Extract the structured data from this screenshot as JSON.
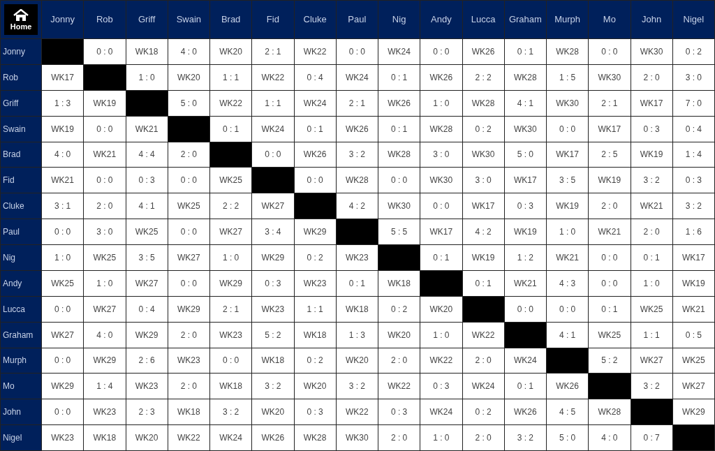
{
  "home_button": {
    "label": "Home"
  },
  "columns": [
    "Jonny",
    "Rob",
    "Griff",
    "Swain",
    "Brad",
    "Fid",
    "Cluke",
    "Paul",
    "Nig",
    "Andy",
    "Lucca",
    "Graham",
    "Murph",
    "Mo",
    "John",
    "Nigel"
  ],
  "rows": [
    {
      "name": "Jonny",
      "cells": [
        null,
        "0 : 0",
        "WK18",
        "4 : 0",
        "WK20",
        "2 : 1",
        "WK22",
        "0 : 0",
        "WK24",
        "0 : 0",
        "WK26",
        "0 : 1",
        "WK28",
        "0 : 0",
        "WK30",
        "0 : 2"
      ]
    },
    {
      "name": "Rob",
      "cells": [
        "WK17",
        null,
        "1 : 0",
        "WK20",
        "1 : 1",
        "WK22",
        "0 : 4",
        "WK24",
        "0 : 1",
        "WK26",
        "2 : 2",
        "WK28",
        "1 : 5",
        "WK30",
        "2 : 0",
        "3 : 0"
      ]
    },
    {
      "name": "Griff",
      "cells": [
        "1 : 3",
        "WK19",
        null,
        "5 : 0",
        "WK22",
        "1 : 1",
        "WK24",
        "2 : 1",
        "WK26",
        "1 : 0",
        "WK28",
        "4 : 1",
        "WK30",
        "2 : 1",
        "WK17",
        "7 : 0"
      ]
    },
    {
      "name": "Swain",
      "cells": [
        "WK19",
        "0 : 0",
        "WK21",
        null,
        "0 : 1",
        "WK24",
        "0 : 1",
        "WK26",
        "0 : 1",
        "WK28",
        "0 : 2",
        "WK30",
        "0 : 0",
        "WK17",
        "0 : 3",
        "0 : 4"
      ]
    },
    {
      "name": "Brad",
      "cells": [
        "4 : 0",
        "WK21",
        "4 : 4",
        "2 : 0",
        null,
        "0 : 0",
        "WK26",
        "3 : 2",
        "WK28",
        "3 : 0",
        "WK30",
        "5 : 0",
        "WK17",
        "2 : 5",
        "WK19",
        "1 : 4"
      ]
    },
    {
      "name": "Fid",
      "cells": [
        "WK21",
        "0 : 0",
        "0 : 3",
        "0 : 0",
        "WK25",
        null,
        "0 : 0",
        "WK28",
        "0 : 0",
        "WK30",
        "3 : 0",
        "WK17",
        "3 : 5",
        "WK19",
        "3 : 2",
        "0 : 3"
      ]
    },
    {
      "name": "Cluke",
      "cells": [
        "3 : 1",
        "2 : 0",
        "4 : 1",
        "WK25",
        "2 : 2",
        "WK27",
        null,
        "4 : 2",
        "WK30",
        "0 : 0",
        "WK17",
        "0 : 3",
        "WK19",
        "2 : 0",
        "WK21",
        "3 : 2"
      ]
    },
    {
      "name": "Paul",
      "cells": [
        "0 : 0",
        "3 : 0",
        "WK25",
        "0 : 0",
        "WK27",
        "3 : 4",
        "WK29",
        null,
        "5 : 5",
        "WK17",
        "4 : 2",
        "WK19",
        "1 : 0",
        "WK21",
        "2 : 0",
        "1 : 6"
      ]
    },
    {
      "name": "Nig",
      "cells": [
        "1 : 0",
        "WK25",
        "3 : 5",
        "WK27",
        "1 : 0",
        "WK29",
        "0 : 2",
        "WK23",
        null,
        "0 : 1",
        "WK19",
        "1 : 2",
        "WK21",
        "0 : 0",
        "0 : 1",
        "WK17"
      ]
    },
    {
      "name": "Andy",
      "cells": [
        "WK25",
        "1 : 0",
        "WK27",
        "0 : 0",
        "WK29",
        "0 : 3",
        "WK23",
        "0 : 1",
        "WK18",
        null,
        "0 : 1",
        "WK21",
        "4 : 3",
        "0 : 0",
        "1 : 0",
        "WK19"
      ]
    },
    {
      "name": "Lucca",
      "cells": [
        "0 : 0",
        "WK27",
        "0 : 4",
        "WK29",
        "2 : 1",
        "WK23",
        "1 : 1",
        "WK18",
        "0 : 2",
        "WK20",
        null,
        "0 : 0",
        "0 : 0",
        "0 : 1",
        "WK25",
        "WK21"
      ]
    },
    {
      "name": "Graham",
      "cells": [
        "WK27",
        "4 : 0",
        "WK29",
        "2 : 0",
        "WK23",
        "5 : 2",
        "WK18",
        "1 : 3",
        "WK20",
        "1 : 0",
        "WK22",
        null,
        "4 : 1",
        "WK25",
        "1 : 1",
        "0 : 5"
      ]
    },
    {
      "name": "Murph",
      "cells": [
        "0 : 0",
        "WK29",
        "2 : 6",
        "WK23",
        "0 : 0",
        "WK18",
        "0 : 2",
        "WK20",
        "2 : 0",
        "WK22",
        "2 : 0",
        "WK24",
        null,
        "5 : 2",
        "WK27",
        "WK25"
      ]
    },
    {
      "name": "Mo",
      "cells": [
        "WK29",
        "1 : 4",
        "WK23",
        "2 : 0",
        "WK18",
        "3 : 2",
        "WK20",
        "3 : 2",
        "WK22",
        "0 : 3",
        "WK24",
        "0 : 1",
        "WK26",
        null,
        "3 : 2",
        "WK27"
      ]
    },
    {
      "name": "John",
      "cells": [
        "0 : 0",
        "WK23",
        "2 : 3",
        "WK18",
        "3 : 2",
        "WK20",
        "0 : 3",
        "WK22",
        "0 : 3",
        "WK24",
        "0 : 2",
        "WK26",
        "4 : 5",
        "WK28",
        null,
        "WK29"
      ]
    },
    {
      "name": "Nigel",
      "cells": [
        "WK23",
        "WK18",
        "WK20",
        "WK22",
        "WK24",
        "WK26",
        "WK28",
        "WK30",
        "2 : 0",
        "1 : 0",
        "2 : 0",
        "3 : 2",
        "5 : 0",
        "4 : 0",
        "0 : 7",
        null
      ]
    }
  ]
}
